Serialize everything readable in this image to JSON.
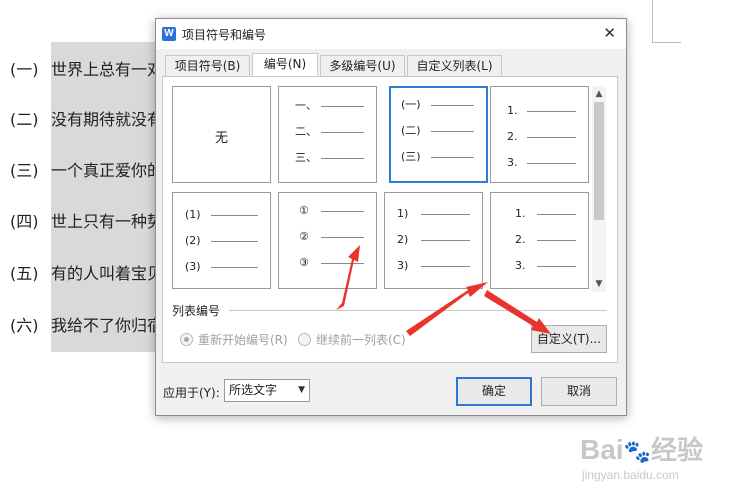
{
  "document": {
    "lines": [
      {
        "num": "(一)",
        "text": "世界上总有一对"
      },
      {
        "num": "(二)",
        "text": "没有期待就没有"
      },
      {
        "num": "(三)",
        "text": "一个真正爱你的"
      },
      {
        "num": "(四)",
        "text": "世上只有一种势"
      },
      {
        "num": "(五)",
        "text": "有的人叫着宝贝"
      },
      {
        "num": "(六)",
        "text": "我给不了你归宿"
      }
    ]
  },
  "dialog": {
    "title": "项目符号和编号",
    "app_icon": "W",
    "close_icon": "close-icon",
    "tabs": [
      {
        "label": "项目符号(B)",
        "active": false
      },
      {
        "label": "编号(N)",
        "active": true
      },
      {
        "label": "多级编号(U)",
        "active": false
      },
      {
        "label": "自定义列表(L)",
        "active": false
      }
    ],
    "options": {
      "none_label": "无",
      "o2": [
        "一、",
        "二、",
        "三、"
      ],
      "o3": [
        "(一)",
        "(二)",
        "(三)"
      ],
      "o4": [
        "1.",
        "2.",
        "3."
      ],
      "o5": [
        "(1)",
        "(2)",
        "(3)"
      ],
      "o6": [
        "①",
        "②",
        "③"
      ],
      "o7": [
        "1)",
        "2)",
        "3)"
      ],
      "o8": [
        "1.",
        "2.",
        "3."
      ]
    },
    "list_numbering": {
      "label": "列表编号",
      "restart": "重新开始编号(R)",
      "continue": "继续前一列表(C)"
    },
    "customize_button": "自定义(T)...",
    "apply_to_label": "应用于(Y):",
    "apply_to_value": "所选文字",
    "ok_button": "确定",
    "cancel_button": "取消"
  },
  "watermark": {
    "logo": "Bai",
    "logo_cn": "经验",
    "url": "jingyan.baidu.com"
  },
  "colors": {
    "selection_border": "#2a80d2",
    "annotation_arrow": "#e8352c",
    "doc_highlight": "#d9d9d9"
  }
}
